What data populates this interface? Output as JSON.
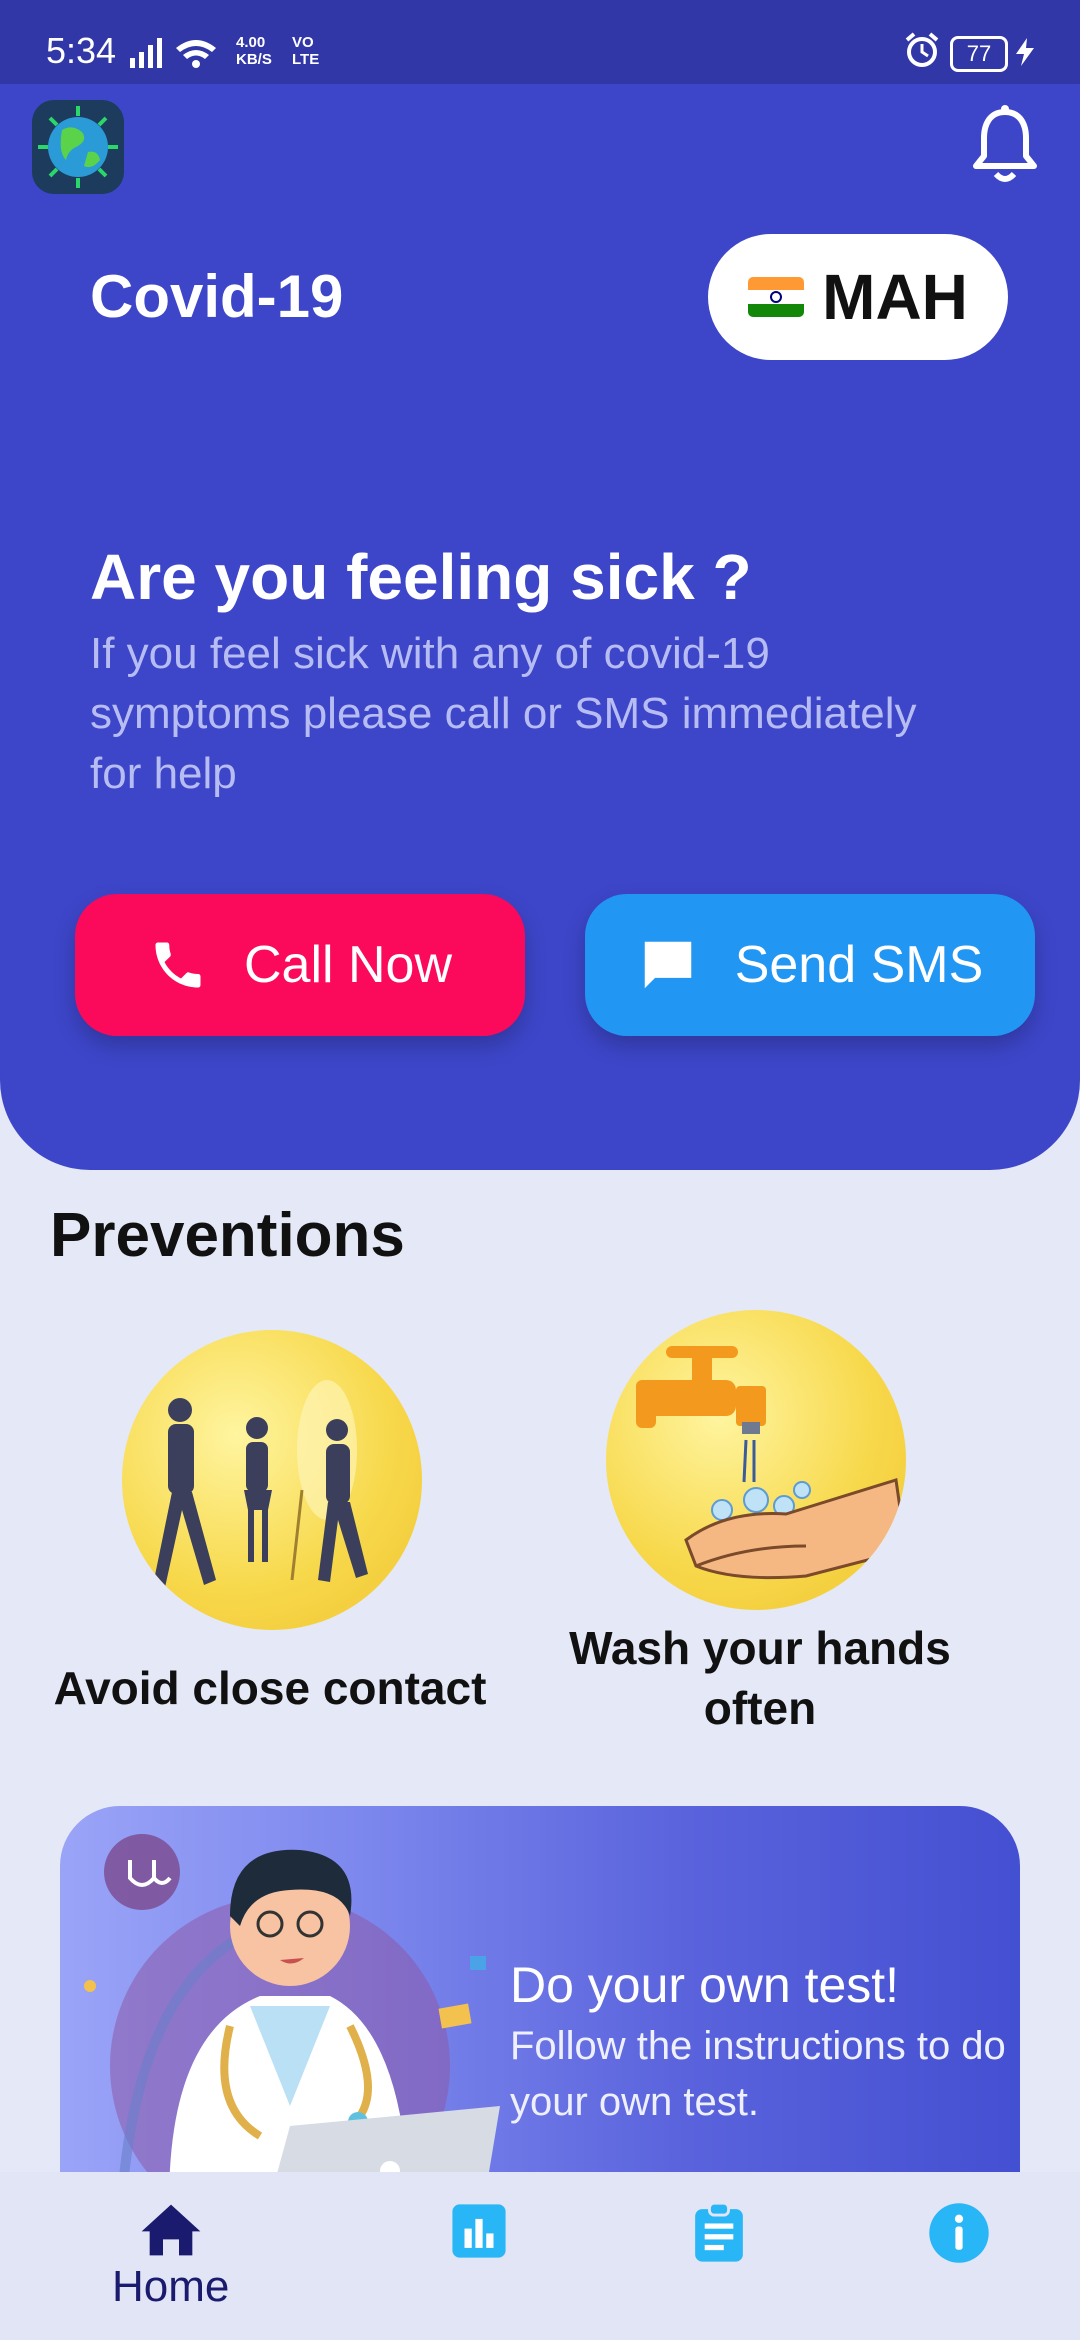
{
  "status_bar": {
    "time": "5:34",
    "network_speed_line1": "4.00",
    "network_speed_line2": "KB/S",
    "network_type_line1": "VO",
    "network_type_line2": "LTE",
    "battery": "77"
  },
  "header": {
    "app_logo_icon": "globe-virus-icon",
    "notification_icon": "bell-icon",
    "title": "Covid-19",
    "region_flag": "india-flag-icon",
    "region_code": "MAH"
  },
  "help_card": {
    "title": "Are you feeling sick ?",
    "description": "If you feel sick with any of covid-19 symptoms please call or SMS immediately for help",
    "call_button": {
      "label": "Call Now",
      "icon": "phone-icon",
      "color": "#fb0a5b"
    },
    "sms_button": {
      "label": "Send SMS",
      "icon": "message-icon",
      "color": "#2296f3"
    }
  },
  "preventions": {
    "title": "Preventions",
    "items": [
      {
        "label": "Avoid close contact",
        "image": "people-distancing-illustration"
      },
      {
        "label": "Wash your hands often",
        "image": "handwashing-illustration"
      }
    ]
  },
  "test_banner": {
    "title": "Do your own test!",
    "description": "Follow the instructions to do your own test.",
    "image": "doctor-with-laptop-illustration"
  },
  "bottom_nav": {
    "items": [
      {
        "label": "Home",
        "icon": "home-icon",
        "active": true
      },
      {
        "label": "",
        "icon": "bar-chart-icon",
        "active": false
      },
      {
        "label": "",
        "icon": "clipboard-icon",
        "active": false
      },
      {
        "label": "",
        "icon": "info-icon",
        "active": false
      }
    ]
  },
  "colors": {
    "primary": "#3d46c9",
    "status_bar": "#3137a6",
    "background": "#e5e8f6",
    "accent_call": "#fb0a5b",
    "accent_sms": "#2296f3",
    "nav_active": "#1a1a6e",
    "nav_inactive": "#29b6f6"
  }
}
